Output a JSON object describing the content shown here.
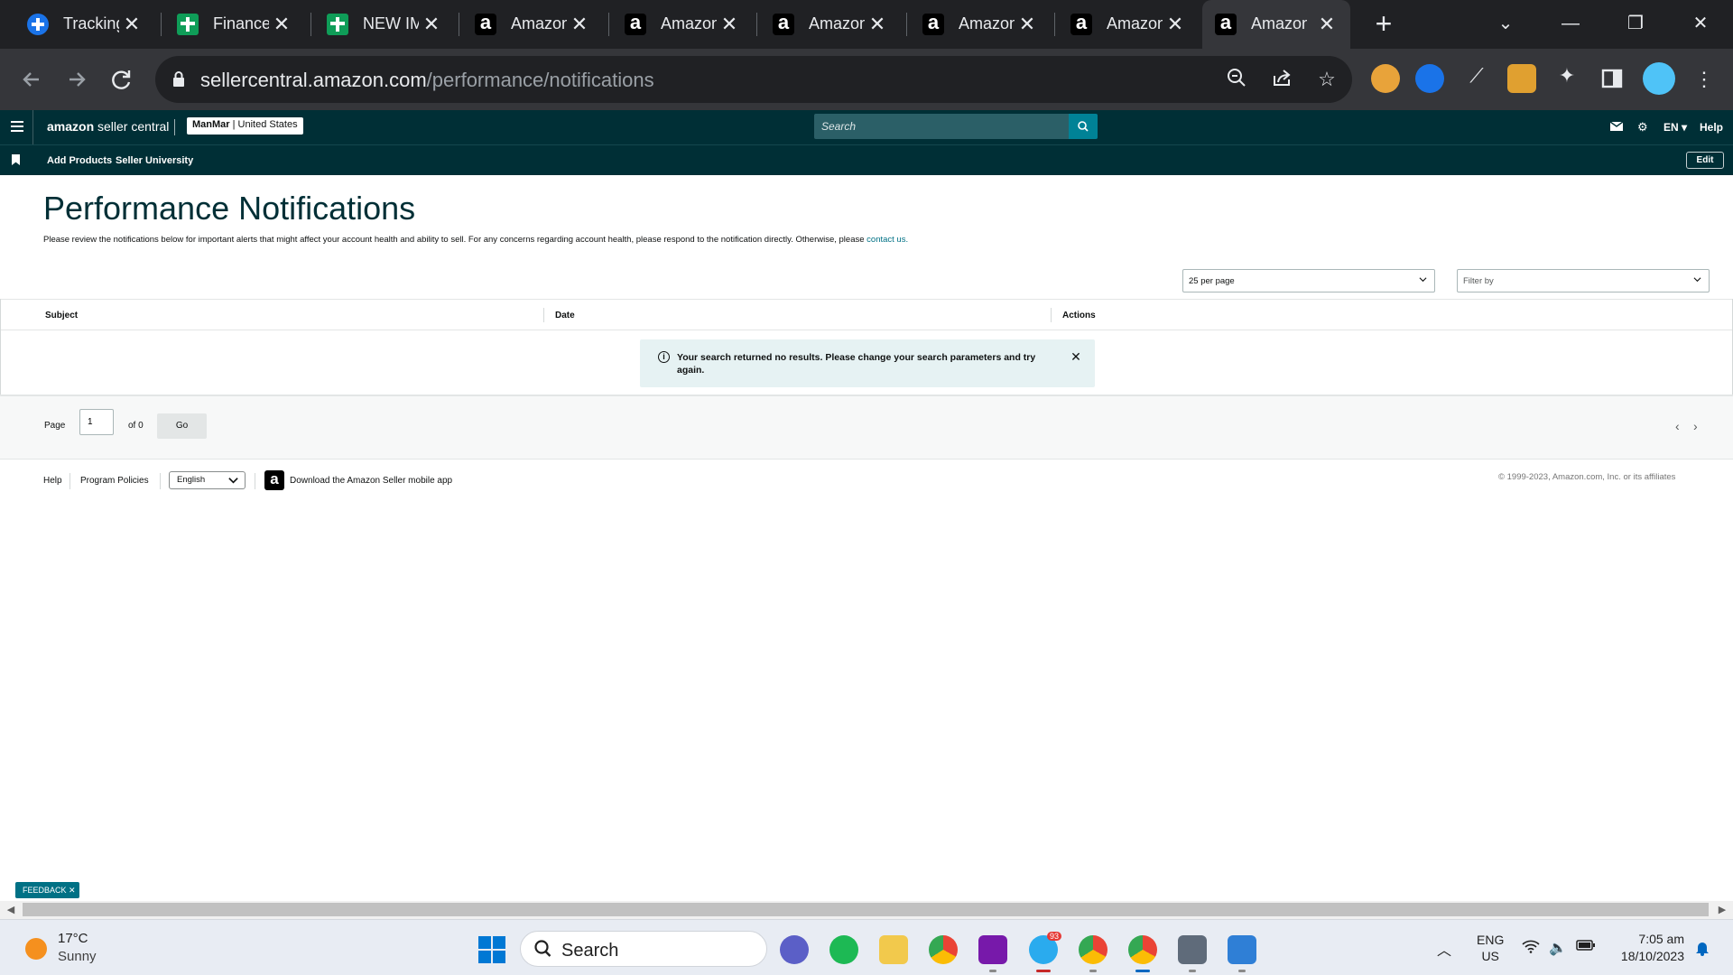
{
  "browser": {
    "tabs": [
      {
        "title": "Tracking",
        "icon": "plus-icon",
        "active": false
      },
      {
        "title": "Finance",
        "icon": "sheets-icon",
        "active": false
      },
      {
        "title": "NEW IM",
        "icon": "sheets-icon",
        "active": false
      },
      {
        "title": "Amazon",
        "icon": "amazon-icon",
        "active": false
      },
      {
        "title": "Amazon",
        "icon": "amazon-icon",
        "active": false
      },
      {
        "title": "Amazon",
        "icon": "amazon-icon",
        "active": false
      },
      {
        "title": "Amazon",
        "icon": "amazon-icon",
        "active": false
      },
      {
        "title": "Amazon",
        "icon": "amazon-icon",
        "active": false
      },
      {
        "title": "Amazon",
        "icon": "amazon-icon",
        "active": true
      }
    ],
    "url_host": "sellercentral.amazon.com",
    "url_path": "/performance/notifications"
  },
  "header": {
    "brand_primary": "amazon",
    "brand_secondary": "seller central",
    "account_name": "ManMar",
    "account_region": "United States",
    "search_placeholder": "Search",
    "language": "EN",
    "help": "Help"
  },
  "subnav": {
    "links": [
      "Add Products",
      "Seller University"
    ],
    "edit": "Edit"
  },
  "page": {
    "title": "Performance Notifications",
    "description": "Please review the notifications below for important alerts that might affect your account health and ability to sell. For any concerns regarding account health, please respond to the notification directly. Otherwise, please",
    "contact_link": "contact us.",
    "per_page": "25 per page",
    "filter_placeholder": "Filter by",
    "columns": [
      "Subject",
      "Date",
      "Actions"
    ],
    "alert_message": "Your search returned no results. Please change your search parameters and try again."
  },
  "pager": {
    "page_label": "Page",
    "page_value": "1",
    "of_label": "of 0",
    "go": "Go"
  },
  "footer": {
    "help": "Help",
    "program_policies": "Program Policies",
    "language": "English",
    "app_link": "Download the Amazon Seller mobile app",
    "copyright": "© 1999-2023, Amazon.com, Inc. or its affiliates",
    "feedback": "FEEDBACK"
  },
  "taskbar": {
    "weather_temp": "17°C",
    "weather_desc": "Sunny",
    "search_label": "Search",
    "lang_line1": "ENG",
    "lang_line2": "US",
    "time": "7:05 am",
    "date": "18/10/2023",
    "telegram_badge": "93"
  },
  "colors": {
    "header_bg": "#002f36",
    "accent": "#008296",
    "alert_bg": "#e6f2f3",
    "link": "#007185"
  }
}
